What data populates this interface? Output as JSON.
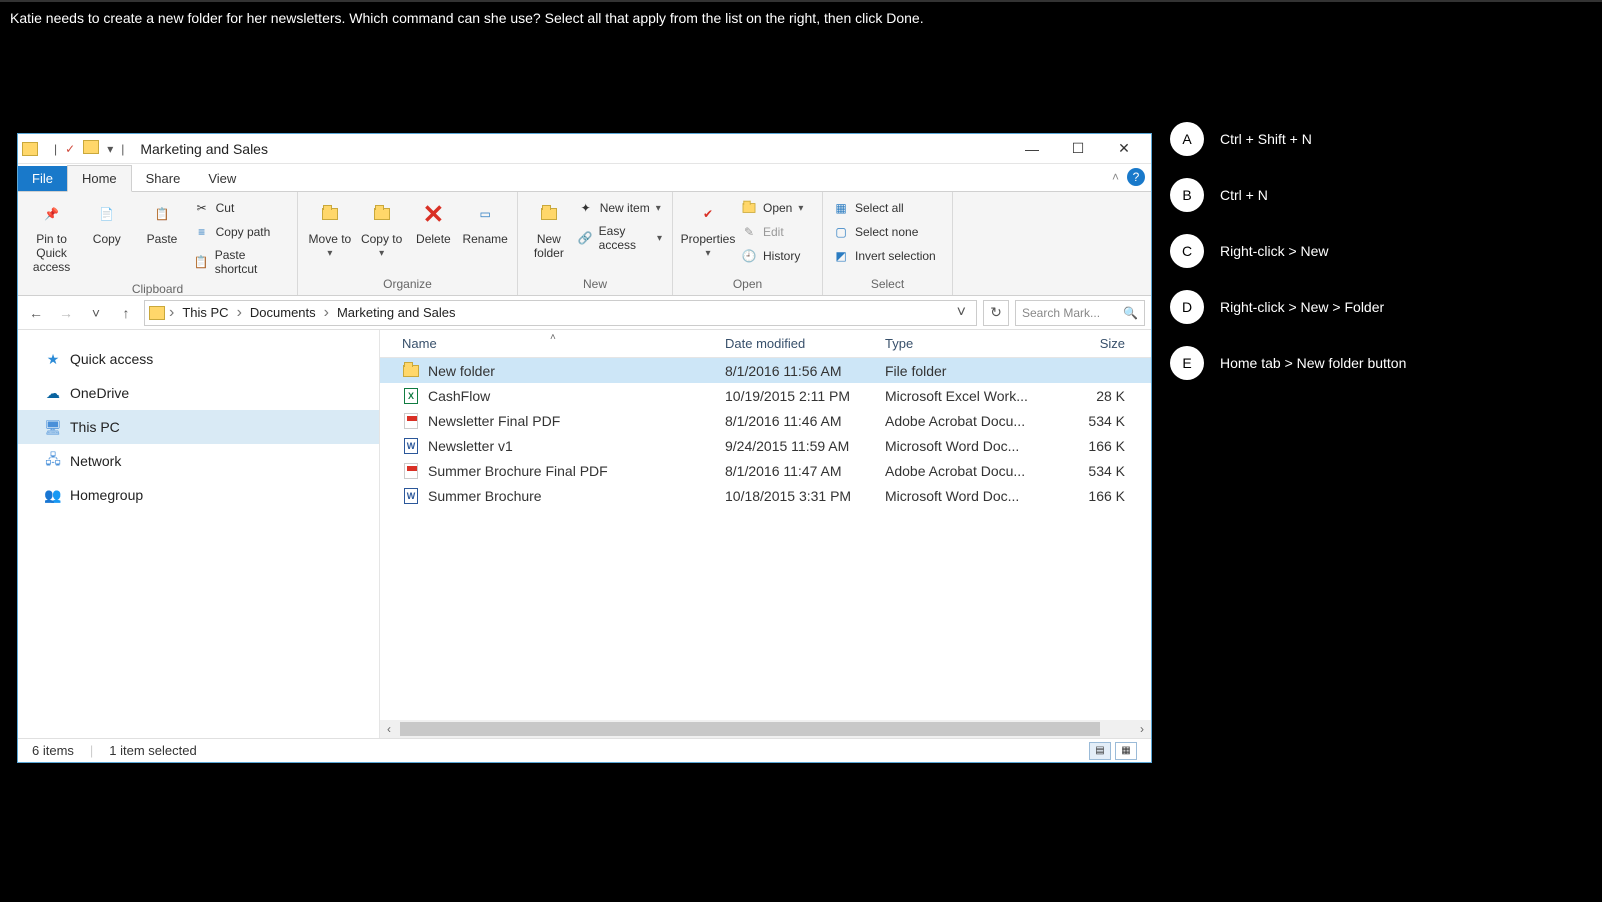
{
  "question": "Katie needs to create a new folder for her newsletters. Which command can she use? Select all that apply from the list on the right, then click Done.",
  "window": {
    "title": "Marketing and Sales",
    "tabs": {
      "file": "File",
      "home": "Home",
      "share": "Share",
      "view": "View"
    },
    "ribbon": {
      "clipboard": {
        "label": "Clipboard",
        "pin": "Pin to Quick access",
        "copy": "Copy",
        "paste": "Paste",
        "cut": "Cut",
        "copypath": "Copy path",
        "pasteshortcut": "Paste shortcut"
      },
      "organize": {
        "label": "Organize",
        "moveto": "Move to",
        "copyto": "Copy to",
        "delete": "Delete",
        "rename": "Rename"
      },
      "new": {
        "label": "New",
        "newfolder": "New folder",
        "newitem": "New item",
        "easyaccess": "Easy access"
      },
      "open": {
        "label": "Open",
        "properties": "Properties",
        "open": "Open",
        "edit": "Edit",
        "history": "History"
      },
      "select": {
        "label": "Select",
        "selectall": "Select all",
        "selectnone": "Select none",
        "invert": "Invert selection"
      }
    },
    "breadcrumbs": [
      "This PC",
      "Documents",
      "Marketing and Sales"
    ],
    "search_placeholder": "Search Mark...",
    "sidebar": [
      {
        "label": "Quick access"
      },
      {
        "label": "OneDrive"
      },
      {
        "label": "This PC"
      },
      {
        "label": "Network"
      },
      {
        "label": "Homegroup"
      }
    ],
    "columns": {
      "name": "Name",
      "date": "Date modified",
      "type": "Type",
      "size": "Size"
    },
    "files": [
      {
        "icon": "folder",
        "name": "New folder",
        "date": "8/1/2016 11:56 AM",
        "type": "File folder",
        "size": "",
        "selected": true
      },
      {
        "icon": "excel",
        "name": "CashFlow",
        "date": "10/19/2015 2:11 PM",
        "type": "Microsoft Excel Work...",
        "size": "28 K"
      },
      {
        "icon": "pdf",
        "name": "Newsletter Final PDF",
        "date": "8/1/2016 11:46 AM",
        "type": "Adobe Acrobat Docu...",
        "size": "534 K"
      },
      {
        "icon": "word",
        "name": "Newsletter v1",
        "date": "9/24/2015 11:59 AM",
        "type": "Microsoft Word Doc...",
        "size": "166 K"
      },
      {
        "icon": "pdf",
        "name": "Summer Brochure Final PDF",
        "date": "8/1/2016 11:47 AM",
        "type": "Adobe Acrobat Docu...",
        "size": "534 K"
      },
      {
        "icon": "word",
        "name": "Summer Brochure",
        "date": "10/18/2015 3:31 PM",
        "type": "Microsoft Word Doc...",
        "size": "166 K"
      }
    ],
    "status": {
      "items": "6 items",
      "selected": "1 item selected"
    }
  },
  "choices": [
    {
      "letter": "A",
      "label": "Ctrl + Shift + N"
    },
    {
      "letter": "B",
      "label": "Ctrl + N"
    },
    {
      "letter": "C",
      "label": "Right-click > New"
    },
    {
      "letter": "D",
      "label": "Right-click > New > Folder"
    },
    {
      "letter": "E",
      "label": "Home tab > New folder button"
    }
  ]
}
